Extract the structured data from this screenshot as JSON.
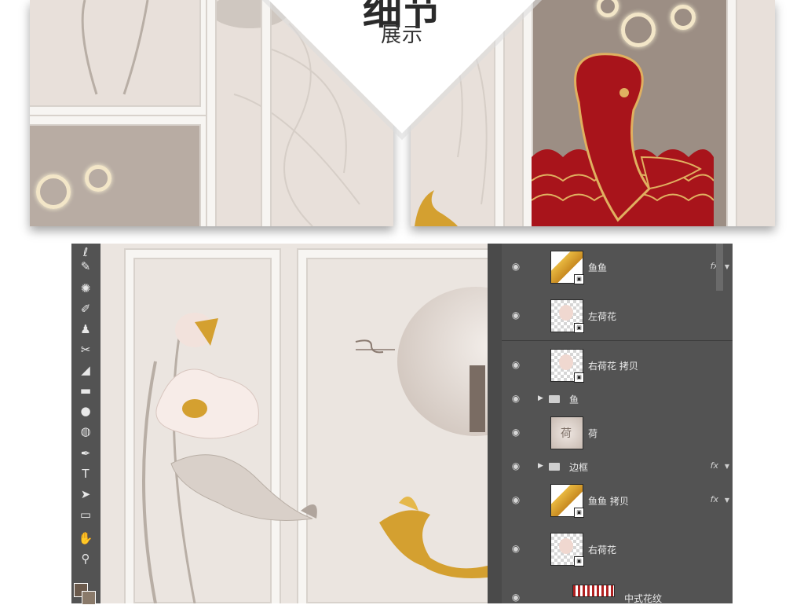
{
  "header": {
    "title": "细节",
    "subtitle": "展示"
  },
  "toolbar": {
    "tools": [
      {
        "name": "lasso-tool-icon",
        "glyph": "ℓ"
      },
      {
        "name": "eyedropper-tool-icon",
        "glyph": "✎"
      },
      {
        "name": "healing-brush-icon",
        "glyph": "✺"
      },
      {
        "name": "brush-tool-icon",
        "glyph": "✐"
      },
      {
        "name": "clone-stamp-icon",
        "glyph": "♟"
      },
      {
        "name": "history-brush-icon",
        "glyph": "✂"
      },
      {
        "name": "eraser-tool-icon",
        "glyph": "◢"
      },
      {
        "name": "gradient-tool-icon",
        "glyph": "▬"
      },
      {
        "name": "blur-tool-icon",
        "glyph": "●"
      },
      {
        "name": "dodge-tool-icon",
        "glyph": "◍"
      },
      {
        "name": "pen-tool-icon",
        "glyph": "✒"
      },
      {
        "name": "type-tool-icon",
        "glyph": "T"
      },
      {
        "name": "path-selection-icon",
        "glyph": "➤"
      },
      {
        "name": "rectangle-tool-icon",
        "glyph": "▭"
      },
      {
        "name": "hand-tool-icon",
        "glyph": "✋"
      },
      {
        "name": "zoom-tool-icon",
        "glyph": "⚲"
      }
    ]
  },
  "layers": [
    {
      "name": "鱼鱼",
      "type": "smart",
      "fx": true,
      "thumb": "fish-gold"
    },
    {
      "name": "左荷花",
      "type": "smart",
      "fx": false,
      "thumb": "lotus"
    },
    {
      "name": "右荷花 拷贝",
      "type": "smart",
      "fx": false,
      "thumb": "lotus"
    },
    {
      "name": "鱼",
      "type": "group",
      "fx": false
    },
    {
      "name": "荷",
      "type": "pixel",
      "fx": false,
      "thumb": "moon",
      "thumb_text": "荷"
    },
    {
      "name": "边框",
      "type": "group",
      "fx": true
    },
    {
      "name": "鱼鱼 拷贝",
      "type": "smart",
      "fx": true,
      "thumb": "fish-gold"
    },
    {
      "name": "右荷花",
      "type": "smart",
      "fx": false,
      "thumb": "lotus"
    },
    {
      "name": "中式花纹",
      "type": "pixel",
      "fx": false,
      "thumb": "pattern"
    }
  ],
  "labels": {
    "fx": "fx"
  },
  "colors": {
    "panel_bg": "#535353",
    "canvas_bg": "#ebe5e0",
    "fish_red": "#a8141b",
    "gold": "#d4a030"
  }
}
